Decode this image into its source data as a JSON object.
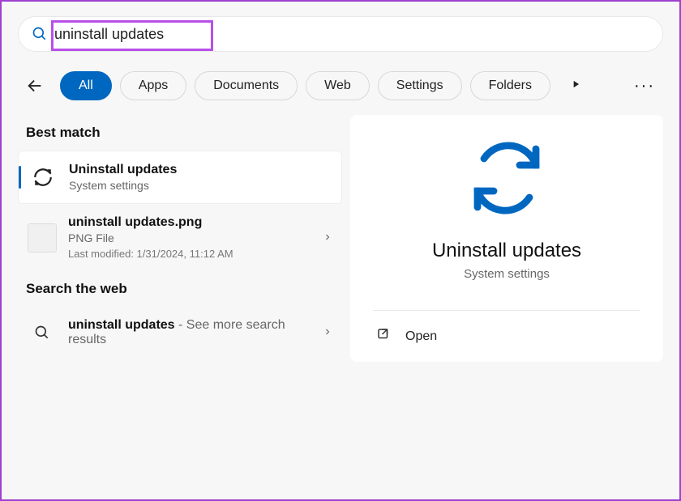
{
  "search": {
    "query": "uninstall updates"
  },
  "filters": {
    "all": "All",
    "apps": "Apps",
    "documents": "Documents",
    "web": "Web",
    "settings": "Settings",
    "folders": "Folders"
  },
  "sections": {
    "best_match": "Best match",
    "search_web": "Search the web"
  },
  "results": {
    "primary": {
      "title": "Uninstall updates",
      "subtitle": "System settings"
    },
    "file": {
      "title": "uninstall updates.png",
      "subtitle": "PNG File",
      "meta": "Last modified: 1/31/2024, 11:12 AM"
    },
    "web": {
      "title": "uninstall updates",
      "suffix": " - See more search results"
    }
  },
  "detail": {
    "title": "Uninstall updates",
    "subtitle": "System settings",
    "open": "Open"
  }
}
